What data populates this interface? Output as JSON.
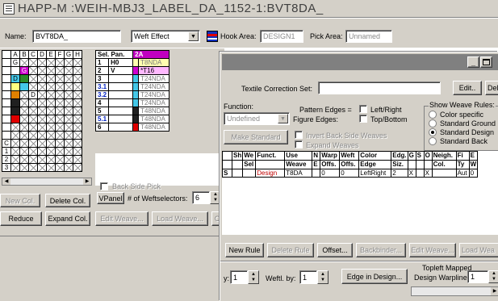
{
  "window_title": "HAPP-M :WEIH-MBJ3_LABEL_DA_1152-1:BVT8DA_",
  "toolbar": {
    "name_label": "Name:",
    "name_value": "BVT8DA_",
    "effect_value": "Weft Effect",
    "hook_area_label": "Hook Area:",
    "hook_area_value": "DESIGN1",
    "pick_area_label": "Pick Area:",
    "pick_area_value": "Unnamed"
  },
  "grid": {
    "columns": [
      "A",
      "B",
      "C",
      "D",
      "E",
      "F",
      "G",
      "H"
    ],
    "row_labels": [
      "",
      "",
      "",
      "",
      "",
      "",
      "",
      "",
      "",
      "",
      "C",
      "1",
      "2",
      "3"
    ]
  },
  "selection_panel": {
    "header": [
      "Sel. Pan.",
      "2A"
    ],
    "rows": [
      {
        "num": "1",
        "name": "H0",
        "value": "T8NDA",
        "color": "#ffffb0",
        "swatch": ""
      },
      {
        "num": "2",
        "name": "V",
        "value": "*T16",
        "color": "#ffb8ff",
        "swatch": "#d000d0"
      },
      {
        "num": "3",
        "name": "",
        "value": "T24NDA",
        "color": "#ffffff",
        "swatch": "#44c8e8"
      },
      {
        "num": "3.1",
        "name": "",
        "value": "T24NDA",
        "color": "#ffffff",
        "swatch": "#44c8e8"
      },
      {
        "num": "3.2",
        "name": "",
        "value": "T24NDA",
        "color": "#ffffff",
        "swatch": "#44c8e8"
      },
      {
        "num": "4",
        "name": "",
        "value": "T24NDA",
        "color": "#ffffff",
        "swatch": "#44c8e8"
      },
      {
        "num": "5",
        "name": "",
        "value": "T48NDA",
        "color": "#ffffff",
        "swatch": "#202020"
      },
      {
        "num": "5.1",
        "name": "",
        "value": "T48NDA",
        "color": "#ffffff",
        "swatch": "#202020"
      },
      {
        "num": "6",
        "name": "",
        "value": "T48NDA",
        "color": "#ffffff",
        "swatch": "#e00000"
      }
    ]
  },
  "left_buttons": {
    "new_col": "New Col.",
    "delete_col": "Delete Col.",
    "reduce": "Reduce",
    "expand_col": "Expand Col.",
    "edit_weave": "Edit Weave...",
    "load_weave": "Load Weave...",
    "back_side_pick": "Back Side Pick",
    "vpanel": "VPanel",
    "weftselectors_label": "# of Weftselectors:",
    "weftselectors_value": "6"
  },
  "dialog": {
    "textile_correction_label": "Textile Correction Set:",
    "textile_correction_value": "",
    "edit_button": "Edit..",
    "delete_button": "Delete",
    "function_label": "Function:",
    "function_value": "Undefined",
    "pattern_edges_label": "Pattern Edges =",
    "figure_edges_label": "Figure Edges:",
    "left_right": "Left/Right",
    "top_bottom": "Top/Bottom",
    "make_standard": "Make Standard",
    "invert_back_side": "Invert Back Side Weaves",
    "expand_weaves": "Expand Weaves",
    "show_rules_label": "Show Weave Rules:",
    "radio_options": [
      "Color specific",
      "Standard Ground",
      "Standard Design",
      "Standard Back"
    ],
    "rules_headers": [
      "",
      "Sh",
      "We",
      "Funct.",
      "Use",
      "N",
      "Warp",
      "Weft",
      "Color",
      "Edg.",
      "G",
      "S",
      "O",
      "Neigh.",
      "Fi",
      "E"
    ],
    "rules_headers2": [
      "",
      "",
      "Sel",
      "",
      "Weave",
      "E",
      "Offs.",
      "Offs.",
      "Edge",
      "Siz.",
      "",
      "",
      "",
      "Col.",
      "Ty",
      "W"
    ],
    "rules_row": [
      "S",
      "",
      "",
      "Design",
      "T8DA",
      "",
      "0",
      "0",
      "LeftRight",
      "2",
      "X",
      "",
      "X",
      "",
      "Aut",
      "0"
    ],
    "buttons": {
      "new_rule": "New Rule",
      "delete_rule": "Delete Rule",
      "offset": "Offset...",
      "backbinder": "Backbinder...",
      "edit_weave": "Edit Weave...",
      "load_weave": "Load Wea"
    },
    "bottom": {
      "by_label": "y:",
      "by_value": "1",
      "weftl_label": "Weftl. by:",
      "weftl_value": "1",
      "edge_in_design": "Edge in Design...",
      "topleft_label": "Topleft Mapped",
      "warpline_label": "Design Warpline:",
      "warpline_value": "1"
    }
  }
}
